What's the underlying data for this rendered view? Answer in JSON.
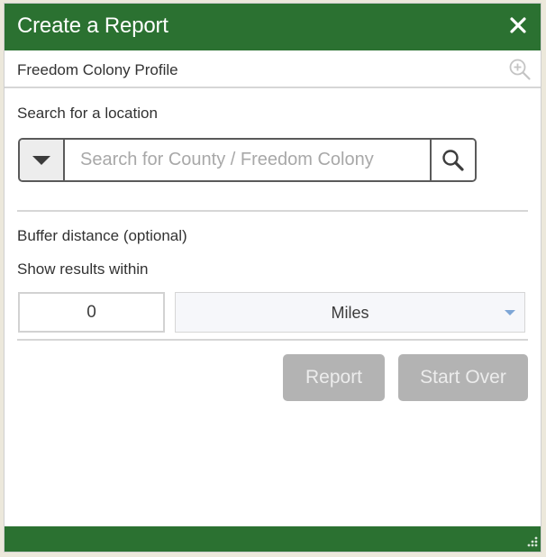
{
  "panel": {
    "title": "Create a Report",
    "close_icon": "close-icon",
    "header_color": "#2b7131"
  },
  "profile": {
    "label": "Freedom Colony Profile",
    "zoom_icon": "zoom-in-icon"
  },
  "search": {
    "section_label": "Search for a location",
    "placeholder": "Search for County / Freedom Colony",
    "value": "",
    "dropdown_icon": "caret-down-icon",
    "button_icon": "search-icon"
  },
  "buffer": {
    "section_label": "Buffer distance (optional)",
    "show_results_label": "Show results within",
    "distance_value": "0",
    "unit_selected": "Miles"
  },
  "actions": {
    "report_label": "Report",
    "start_over_label": "Start Over",
    "disabled_color": "#b3b3b3"
  },
  "footer": {
    "resize_icon": "resize-handle-icon"
  }
}
